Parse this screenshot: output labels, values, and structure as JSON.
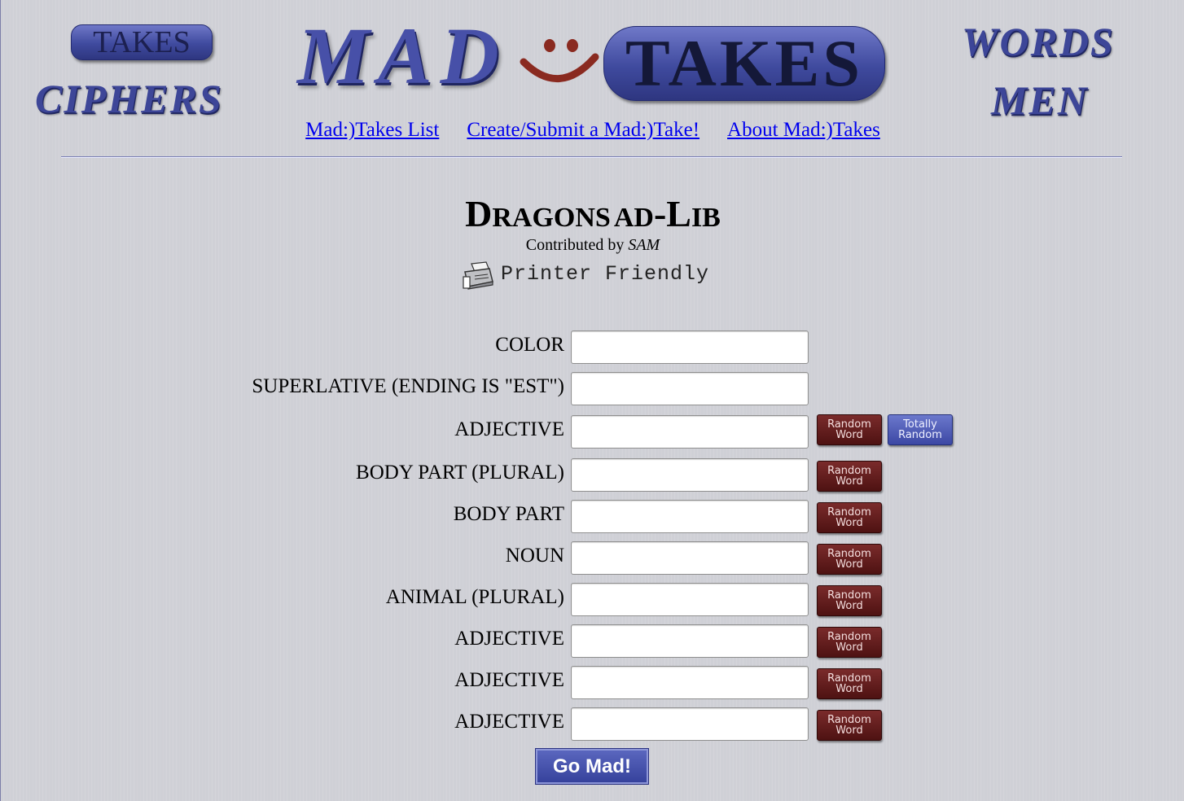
{
  "logos": {
    "left_pill": "TAKES",
    "left_word": "CIPHERS",
    "center_left": "MAD",
    "center_smiley": "☺",
    "center_pill": "TAKES",
    "right_top": "WORDS",
    "right_bottom": "MEN"
  },
  "nav": {
    "list": "Mad:)Takes List",
    "create": "Create/Submit a Mad:)Take!",
    "about": "About Mad:)Takes"
  },
  "story": {
    "title_d": "D",
    "title_ragons": "RAGONS",
    "title_ad": "AD",
    "title_dash": "-",
    "title_l": "L",
    "title_ib": "IB",
    "contributed_prefix": "Contributed by",
    "author": "SAM",
    "printer_friendly": "Printer Friendly"
  },
  "fields": [
    {
      "label": "COLOR"
    },
    {
      "label": "SUPERLATIVE (ENDING IS \"EST\")"
    },
    {
      "label": "ADJECTIVE"
    },
    {
      "label": "BODY PART (PLURAL)"
    },
    {
      "label": "BODY PART"
    },
    {
      "label": "NOUN"
    },
    {
      "label": "ANIMAL (PLURAL)"
    },
    {
      "label": "ADJECTIVE"
    },
    {
      "label": "ADJECTIVE"
    },
    {
      "label": "ADJECTIVE"
    }
  ],
  "buttons": {
    "random_word_line1": "Random",
    "random_word_line2": "Word",
    "totally_random_line1": "Totally",
    "totally_random_line2": "Random",
    "submit": "Go Mad!"
  },
  "colors": {
    "background": "#cfd0d6",
    "link": "#0000ee",
    "random_button": "#5e1a1a",
    "totally_random_button": "#4a56b4",
    "submit_button": "#414eaa"
  }
}
